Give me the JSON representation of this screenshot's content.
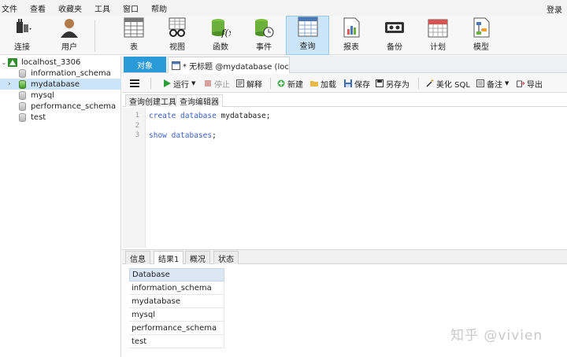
{
  "menu": {
    "items": [
      "文件",
      "查看",
      "收藏夹",
      "工具",
      "窗口",
      "帮助"
    ],
    "login": "登录"
  },
  "toolbar": {
    "connect": "连接",
    "user": "用户",
    "table": "表",
    "view": "视图",
    "function": "函数",
    "event": "事件",
    "query": "查询",
    "report": "报表",
    "backup": "备份",
    "schedule": "计划",
    "model": "模型"
  },
  "sidebar": {
    "connection": "localhost_3306",
    "databases": [
      "information_schema",
      "mydatabase",
      "mysql",
      "performance_schema",
      "test"
    ],
    "selected_index": 1
  },
  "tabs": {
    "objects": "对象",
    "query_tab": "* 无标题 @mydatabase (loc..."
  },
  "editor_toolbar": {
    "run": "运行",
    "stop": "停止",
    "explain": "解释",
    "new": "新建",
    "load": "加载",
    "save": "保存",
    "save_as": "另存为",
    "beautify": "美化 SQL",
    "comment": "备注",
    "export": "导出"
  },
  "subtabs": {
    "builder": "查询创建工具",
    "editor": "查询编辑器"
  },
  "code": {
    "lines": [
      {
        "num": "1",
        "kw1": "create database",
        "rest": " mydatabase;"
      },
      {
        "num": "2",
        "kw1": "",
        "rest": ""
      },
      {
        "num": "3",
        "kw1": "show databases",
        "rest": ";"
      }
    ]
  },
  "result_tabs": {
    "info": "信息",
    "result1": "结果1",
    "profile": "概况",
    "status": "状态"
  },
  "result": {
    "header": "Database",
    "rows": [
      "information_schema",
      "mydatabase",
      "mysql",
      "performance_schema",
      "test"
    ]
  },
  "watermark": "知乎 @vivien",
  "colors": {
    "accent": "#2a9ad9",
    "selection": "#cce4f7",
    "keyword": "#3a5fc8"
  }
}
